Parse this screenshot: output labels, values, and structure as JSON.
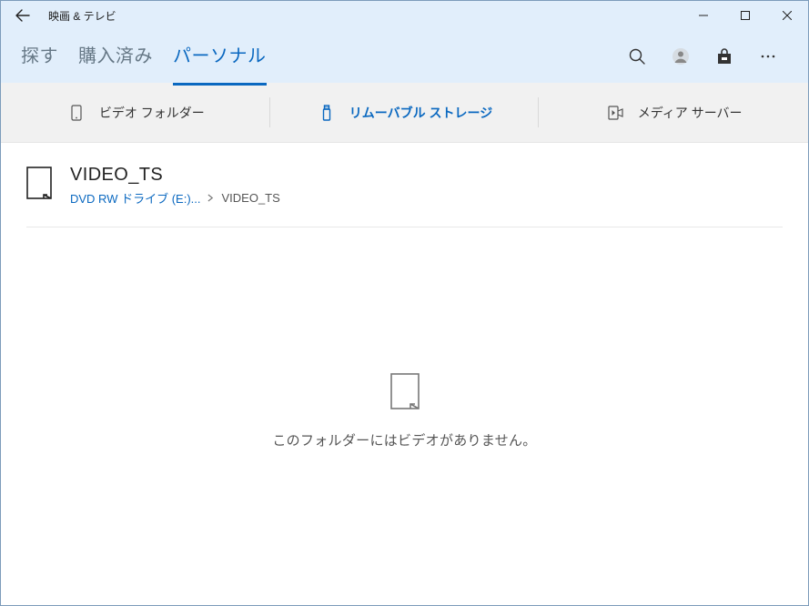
{
  "titlebar": {
    "app_name": "映画 & テレビ"
  },
  "tabs": {
    "explore": "探す",
    "purchased": "購入済み",
    "personal": "パーソナル"
  },
  "subtabs": {
    "video_folders": "ビデオ フォルダー",
    "removable": "リムーバブル ストレージ",
    "media_servers": "メディア サーバー"
  },
  "folder": {
    "title": "VIDEO_TS",
    "breadcrumb_link": "DVD RW ドライブ (E:)...",
    "breadcrumb_current": "VIDEO_TS"
  },
  "empty_state": {
    "message": "このフォルダーにはビデオがありません。"
  }
}
